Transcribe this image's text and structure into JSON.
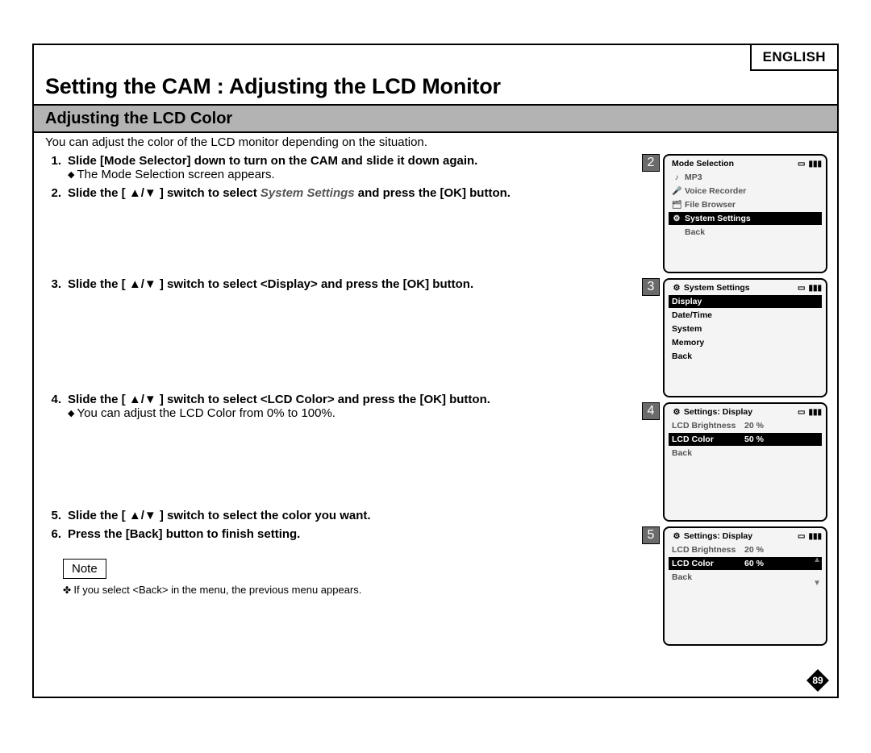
{
  "lang": "ENGLISH",
  "main_title": "Setting the CAM : Adjusting the LCD Monitor",
  "sub_title": "Adjusting the LCD Color",
  "intro": "You can adjust the color of the LCD monitor depending on the situation.",
  "steps": [
    {
      "num": "1.",
      "text": "Slide [Mode Selector] down to turn on the CAM and slide it down again.",
      "sub": "The Mode Selection screen appears."
    },
    {
      "num": "2.",
      "text_pre": "Slide the [ ▲/▼ ] switch to select ",
      "text_em": "System Settings",
      "text_post": " and press the [OK] button."
    },
    {
      "num": "3.",
      "text": "Slide the [ ▲/▼ ] switch to select <Display> and press the [OK] button."
    },
    {
      "num": "4.",
      "text": "Slide the [ ▲/▼ ] switch to select <LCD Color> and press the [OK] button.",
      "sub": "You can adjust the LCD Color from 0% to 100%."
    },
    {
      "num": "5.",
      "text": "Slide the [ ▲/▼ ] switch to select the color you want."
    },
    {
      "num": "6.",
      "text": "Press the [Back] button to finish setting."
    }
  ],
  "screens": {
    "s2": {
      "num": "2",
      "title": "Mode Selection",
      "items": [
        {
          "icon": "♪",
          "label": "MP3",
          "sel": false
        },
        {
          "icon": "🎤",
          "label": "Voice Recorder",
          "sel": false
        },
        {
          "icon": "🗂",
          "label": "File Browser",
          "sel": false
        },
        {
          "icon": "⚙",
          "label": "System Settings",
          "sel": true
        },
        {
          "icon": "",
          "label": "Back",
          "sel": false
        }
      ]
    },
    "s3": {
      "num": "3",
      "title": "System Settings",
      "title_icon": "⚙",
      "items": [
        {
          "label": "Display",
          "sel": true
        },
        {
          "label": "Date/Time",
          "sel": false
        },
        {
          "label": "System",
          "sel": false
        },
        {
          "label": "Memory",
          "sel": false
        },
        {
          "label": "Back",
          "sel": false
        }
      ]
    },
    "s4": {
      "num": "4",
      "title": "Settings: Display",
      "title_icon": "⚙",
      "rows": [
        {
          "label": "LCD Brightness",
          "value": "20 %",
          "sel": false
        },
        {
          "label": "LCD Color",
          "value": "50 %",
          "sel": true
        },
        {
          "label": "Back",
          "value": "",
          "sel": false
        }
      ]
    },
    "s5": {
      "num": "5",
      "title": "Settings: Display",
      "title_icon": "⚙",
      "rows": [
        {
          "label": "LCD Brightness",
          "value": "20 %",
          "sel": false
        },
        {
          "label": "LCD Color",
          "value": "60 %",
          "sel": true
        },
        {
          "label": "Back",
          "value": "",
          "sel": false
        }
      ]
    }
  },
  "note_label": "Note",
  "note_text": "If you select <Back> in the menu, the previous menu appears.",
  "page_num": "89"
}
